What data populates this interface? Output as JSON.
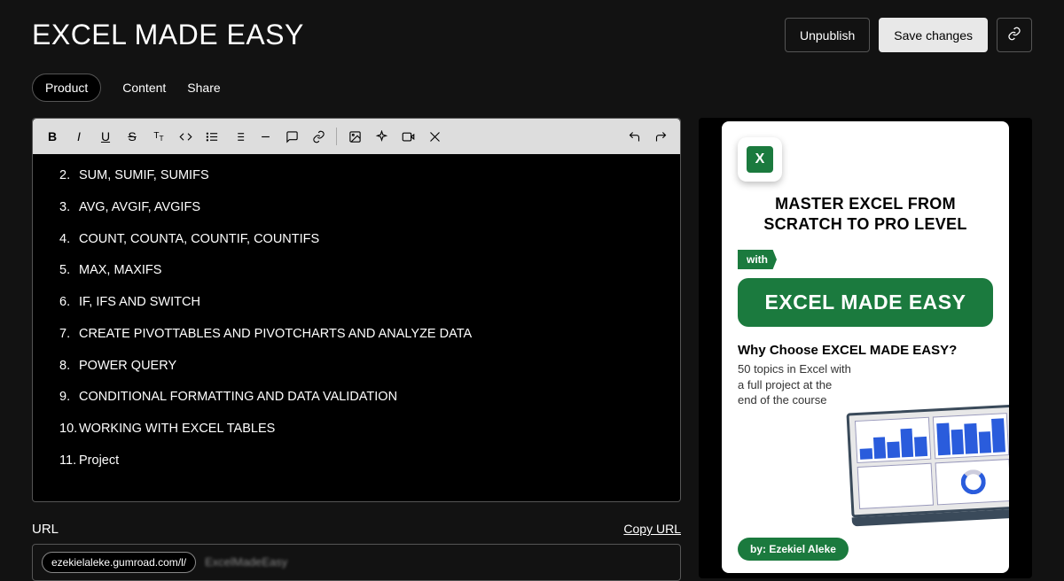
{
  "header": {
    "title": "EXCEL MADE EASY",
    "unpublish": "Unpublish",
    "save": "Save changes"
  },
  "tabs": {
    "product": "Product",
    "content": "Content",
    "share": "Share"
  },
  "editor": {
    "items": [
      "SUM, SUMIF, SUMIFS",
      "AVG, AVGIF, AVGIFS",
      "COUNT, COUNTA, COUNTIF, COUNTIFS",
      "MAX, MAXIFS",
      "IF, IFS AND SWITCH",
      "CREATE PIVOTTABLES AND PIVOTCHARTS AND ANALYZE DATA",
      "POWER QUERY",
      "CONDITIONAL FORMATTING AND DATA VALIDATION",
      "WORKING WITH EXCEL TABLES",
      "Project"
    ]
  },
  "url": {
    "label": "URL",
    "copy": "Copy URL",
    "domain": "ezekielaleke.gumroad.com/l/",
    "slug": "ExcelMadeEasy"
  },
  "cover": {
    "excel_letter": "X",
    "h1": "MASTER EXCEL FROM SCRATCH TO PRO LEVEL",
    "with": "with",
    "badge": "EXCEL MADE EASY",
    "why_title": "Why Choose EXCEL MADE EASY?",
    "why_l1": "50 topics in Excel with",
    "why_l2": "a full project at the",
    "why_l3": "end of the course",
    "author": "by: Ezekiel Aleke"
  }
}
